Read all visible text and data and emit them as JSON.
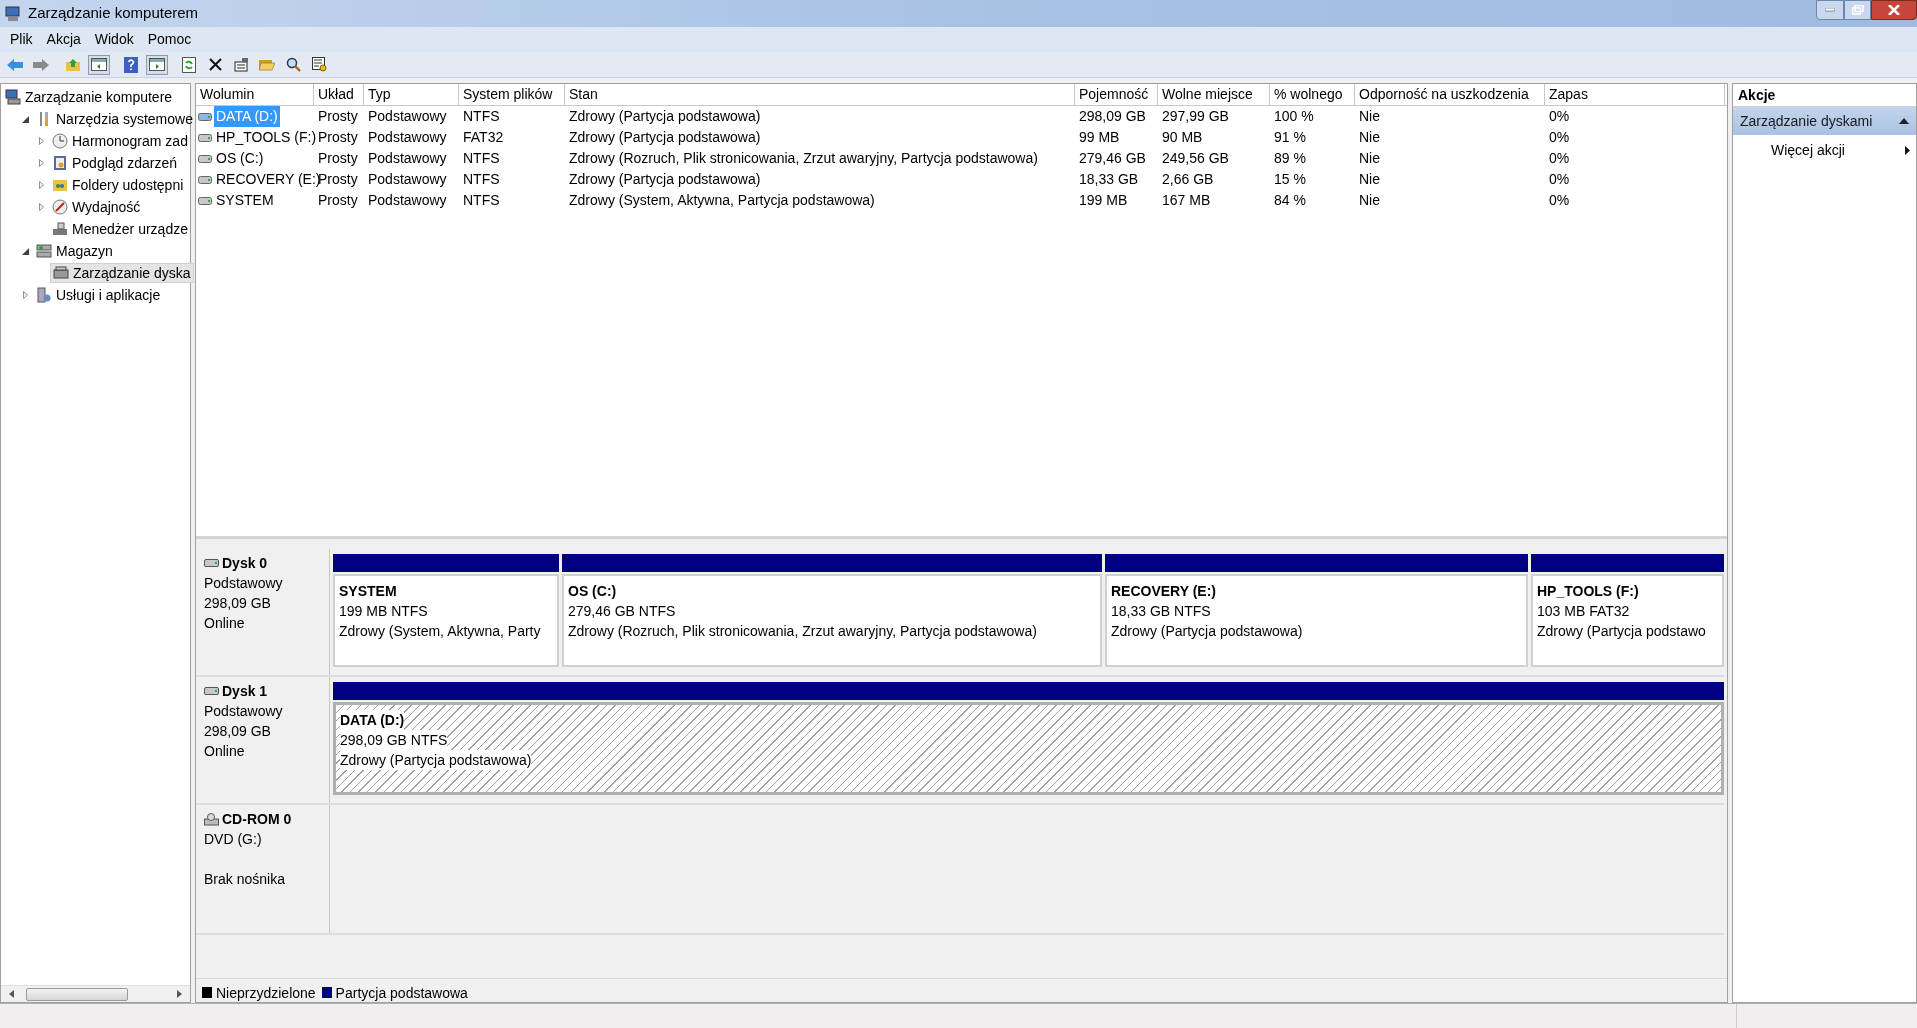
{
  "window": {
    "title": "Zarządzanie komputerem"
  },
  "menu": [
    "Plik",
    "Akcja",
    "Widok",
    "Pomoc"
  ],
  "tree": [
    {
      "label": "Zarządzanie komputere",
      "selected": false,
      "children": [
        {
          "label": "Narzędzia systemowe",
          "expanded": true,
          "selected": false,
          "children": [
            {
              "label": "Harmonogram zad",
              "expanded": false,
              "selected": false
            },
            {
              "label": "Podgląd zdarzeń",
              "expanded": false,
              "selected": false
            },
            {
              "label": "Foldery udostępni",
              "expanded": false,
              "selected": false
            },
            {
              "label": "Wydajność",
              "expanded": false,
              "selected": false
            },
            {
              "label": "Menedżer urządze",
              "selected": false
            }
          ]
        },
        {
          "label": "Magazyn",
          "expanded": true,
          "selected": false,
          "children": [
            {
              "label": "Zarządzanie dyska",
              "selected": true
            }
          ]
        },
        {
          "label": "Usługi i aplikacje",
          "expanded": false,
          "selected": false
        }
      ]
    }
  ],
  "table": {
    "columns": [
      "Wolumin",
      "Układ",
      "Typ",
      "System plików",
      "Stan",
      "Pojemność",
      "Wolne miejsce",
      "% wolnego",
      "Odporność na uszkodzenia",
      "Zapas"
    ],
    "rows": [
      {
        "selected": true,
        "cells": [
          "DATA (D:)",
          "Prosty",
          "Podstawowy",
          "NTFS",
          "Zdrowy (Partycja podstawowa)",
          "298,09 GB",
          "297,99 GB",
          "100 %",
          "Nie",
          "0%"
        ]
      },
      {
        "selected": false,
        "cells": [
          "HP_TOOLS (F:)",
          "Prosty",
          "Podstawowy",
          "FAT32",
          "Zdrowy (Partycja podstawowa)",
          "99 MB",
          "90 MB",
          "91 %",
          "Nie",
          "0%"
        ]
      },
      {
        "selected": false,
        "cells": [
          "OS (C:)",
          "Prosty",
          "Podstawowy",
          "NTFS",
          "Zdrowy (Rozruch, Plik stronicowania, Zrzut awaryjny, Partycja podstawowa)",
          "279,46 GB",
          "249,56 GB",
          "89 %",
          "Nie",
          "0%"
        ]
      },
      {
        "selected": false,
        "cells": [
          "RECOVERY (E:)",
          "Prosty",
          "Podstawowy",
          "NTFS",
          "Zdrowy (Partycja podstawowa)",
          "18,33 GB",
          "2,66 GB",
          "15 %",
          "Nie",
          "0%"
        ]
      },
      {
        "selected": false,
        "cells": [
          "SYSTEM",
          "Prosty",
          "Podstawowy",
          "NTFS",
          "Zdrowy (System, Aktywna, Partycja podstawowa)",
          "199 MB",
          "167 MB",
          "84 %",
          "Nie",
          "0%"
        ]
      }
    ]
  },
  "disks": [
    {
      "kind": "disk",
      "name": "Dysk 0",
      "lines": [
        "Podstawowy",
        "298,09 GB",
        "Online"
      ],
      "partitions": [
        {
          "name": "SYSTEM",
          "size": "199 MB NTFS",
          "status": "Zdrowy (System, Aktywna, Party",
          "selected": false
        },
        {
          "name": "OS  (C:)",
          "size": "279,46 GB NTFS",
          "status": "Zdrowy (Rozruch, Plik stronicowania, Zrzut awaryjny, Partycja podstawowa)",
          "selected": false
        },
        {
          "name": "RECOVERY  (E:)",
          "size": "18,33 GB NTFS",
          "status": "Zdrowy (Partycja podstawowa)",
          "selected": false
        },
        {
          "name": "HP_TOOLS  (F:)",
          "size": "103 MB FAT32",
          "status": "Zdrowy (Partycja podstawo",
          "selected": false
        }
      ]
    },
    {
      "kind": "disk",
      "name": "Dysk 1",
      "lines": [
        "Podstawowy",
        "298,09 GB",
        "Online"
      ],
      "partitions": [
        {
          "name": "DATA  (D:)",
          "size": "298,09 GB NTFS",
          "status": "Zdrowy (Partycja podstawowa)",
          "selected": true
        }
      ]
    },
    {
      "kind": "cdrom",
      "name": "CD-ROM 0",
      "lines": [
        "DVD (G:)",
        "Brak nośnika"
      ]
    }
  ],
  "legend": [
    {
      "label": "Nieprzydzielone",
      "color": "#000000"
    },
    {
      "label": "Partycja podstawowa",
      "color": "#000080"
    }
  ],
  "actions": {
    "title": "Akcje",
    "items": [
      {
        "kind": "header",
        "label": "Zarządzanie dyskami"
      },
      {
        "kind": "item",
        "label": "Więcej akcji"
      }
    ]
  }
}
